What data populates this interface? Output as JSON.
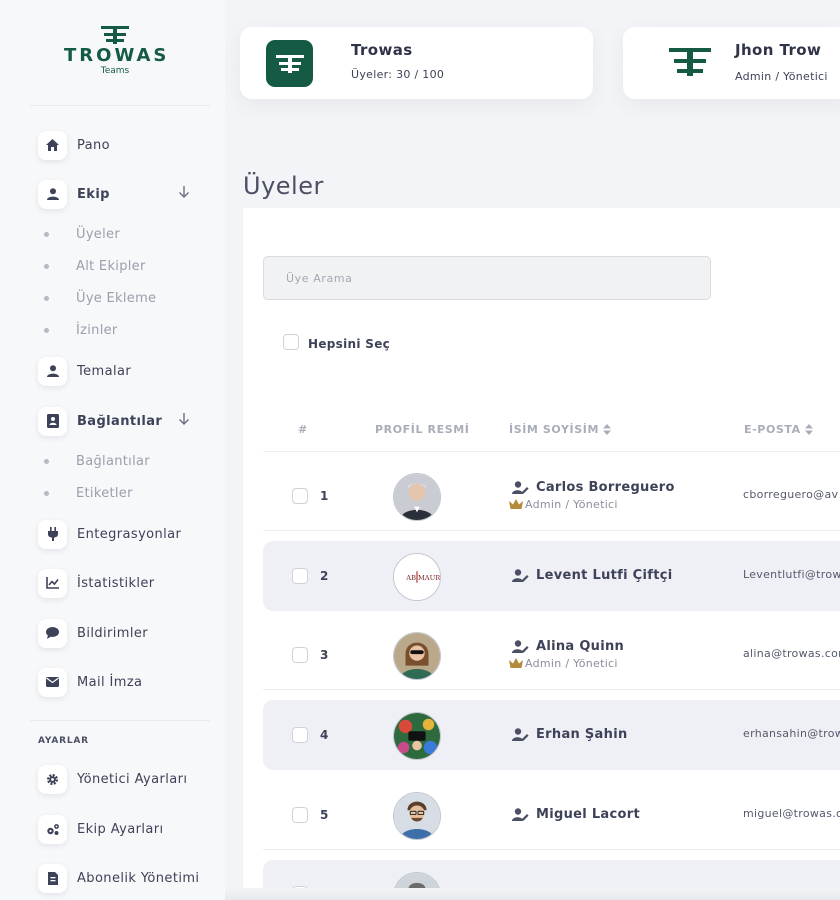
{
  "brand": {
    "name": "TROWAS",
    "sub": "Teams",
    "accent": "#145a44"
  },
  "sidebar": {
    "items": [
      {
        "label": "Pano",
        "icon": "home-icon"
      },
      {
        "label": "Ekip",
        "icon": "user-icon",
        "expanded": true,
        "children": [
          "Üyeler",
          "Alt Ekipler",
          "Üye Ekleme",
          "İzinler"
        ]
      },
      {
        "label": "Temalar",
        "icon": "user-icon"
      },
      {
        "label": "Bağlantılar",
        "icon": "contact-card-icon",
        "expanded": true,
        "children": [
          "Bağlantılar",
          "Etiketler"
        ]
      },
      {
        "label": "Entegrasyonlar",
        "icon": "plug-icon"
      },
      {
        "label": "İstatistikler",
        "icon": "chart-icon"
      },
      {
        "label": "Bildirimler",
        "icon": "chat-bubble-icon"
      },
      {
        "label": "Mail İmza",
        "icon": "envelope-icon"
      }
    ],
    "settings_title": "AYARLAR",
    "settings": [
      {
        "label": "Yönetici Ayarları",
        "icon": "gear-icon"
      },
      {
        "label": "Ekip Ayarları",
        "icon": "gears-icon"
      },
      {
        "label": "Abonelik Yönetimi",
        "icon": "file-icon"
      }
    ]
  },
  "team_card": {
    "title": "Trowas",
    "subtitle": "Üyeler: 30 / 100"
  },
  "user_card": {
    "name": "Jhon Trow",
    "role": "Admin / Yönetici"
  },
  "page_title": "Üyeler",
  "search": {
    "placeholder": "Üye Arama"
  },
  "select_all": "Hepsini Seç",
  "table": {
    "headers": [
      "#",
      "PROFİL RESMİ",
      "İSİM SOYİSİM",
      "E-POSTA"
    ],
    "rows": [
      {
        "num": "1",
        "name": "Carlos Borreguero",
        "role": "Admin / Yönetici",
        "email": "cborreguero@av"
      },
      {
        "num": "2",
        "name": "Levent Lutfi Çiftçi",
        "role": "",
        "email": "Leventlutfi@trow"
      },
      {
        "num": "3",
        "name": "Alina Quinn",
        "role": "Admin / Yönetici",
        "email": "alina@trowas.cor"
      },
      {
        "num": "4",
        "name": "Erhan Şahin",
        "role": "",
        "email": "erhansahin@trow"
      },
      {
        "num": "5",
        "name": "Miguel Lacort",
        "role": "",
        "email": "miguel@trowas.c"
      }
    ]
  }
}
